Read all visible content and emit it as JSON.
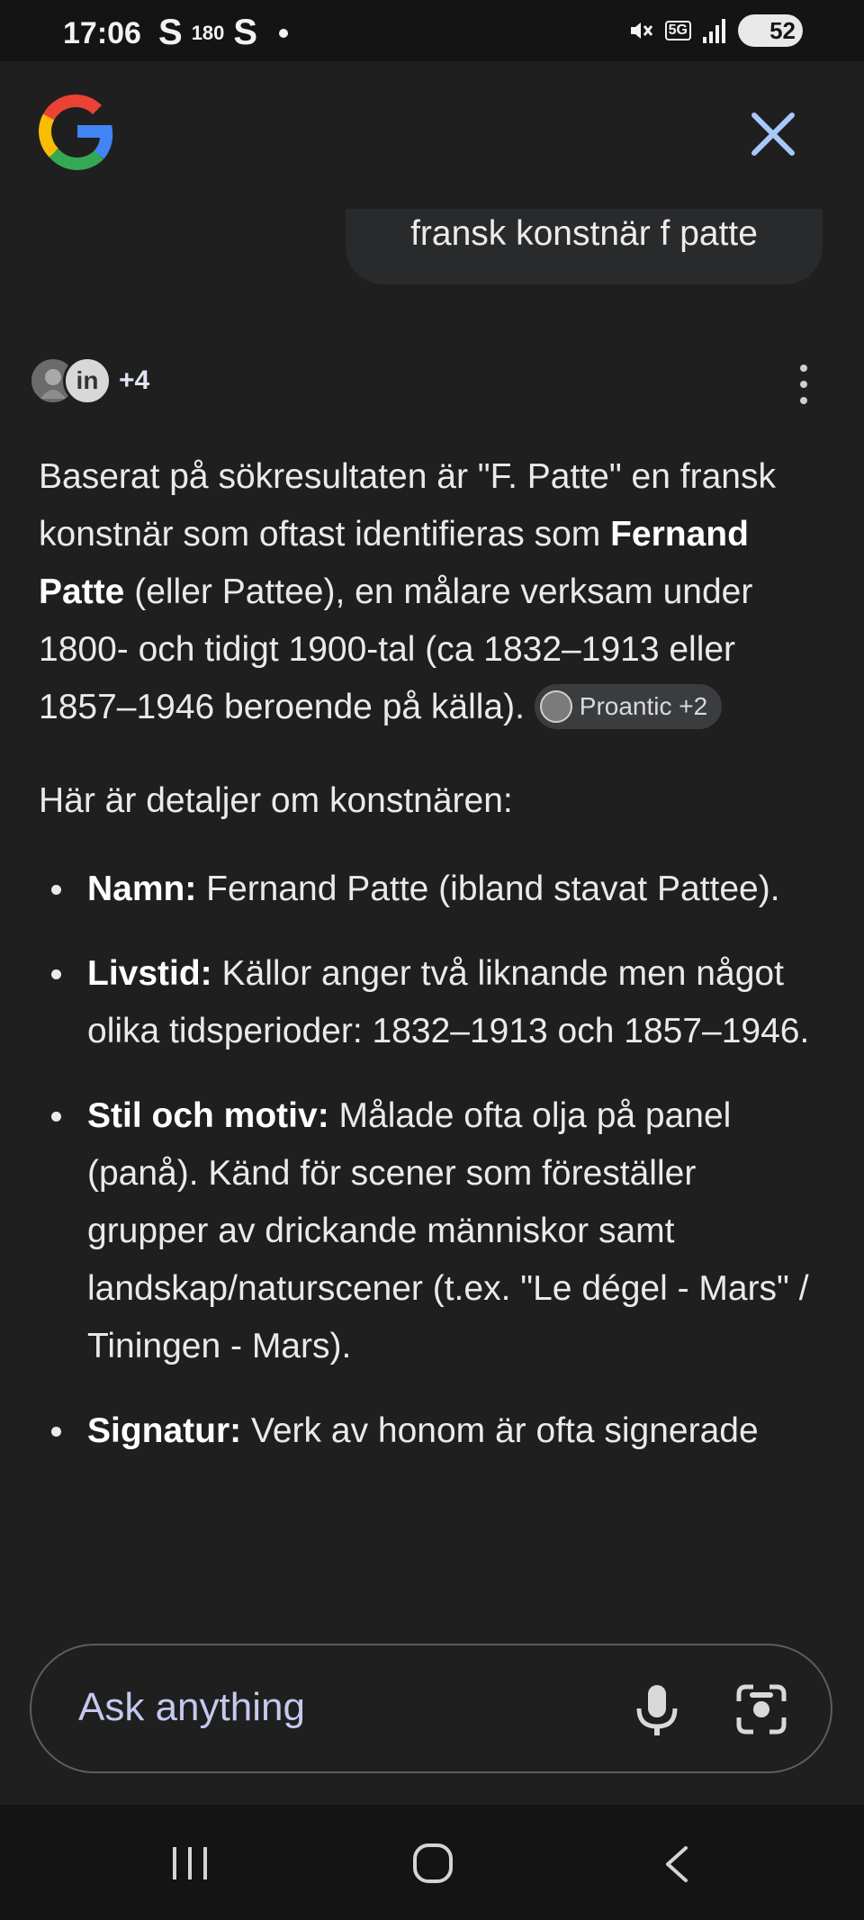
{
  "status_bar": {
    "time": "17:06",
    "left_icons": [
      "S",
      "180",
      "S"
    ],
    "network": "5G",
    "battery": "52"
  },
  "header": {
    "logo_icon": "google-g-icon",
    "close_icon": "close-icon"
  },
  "query": "fransk konstnär f patte",
  "sources": {
    "more": "+4"
  },
  "answer": {
    "intro_prefix": "Baserat på sökresultaten är \"F. Patte\" en fransk konstnär som oftast identifieras som ",
    "intro_bold": "Fernand Patte",
    "intro_suffix": " (eller Pattee), en målare verksam under 1800- och tidigt 1900-tal (ca 1832–1913 eller 1857–1946 beroende på källa). ",
    "citation": "Proantic +2",
    "details_heading": "Här är detaljer om konstnären:",
    "bullets": [
      {
        "label": "Namn:",
        "text": " Fernand Patte (ibland stavat Pattee)."
      },
      {
        "label": "Livstid:",
        "text": " Källor anger två liknande men något olika tidsperioder: 1832–1913 och 1857–1946."
      },
      {
        "label": "Stil och motiv:",
        "text": " Målade ofta olja på panel (panå). Känd för scener som föreställer grupper av drickande människor samt landskap/naturscener (t.ex. \"Le dégel - Mars\" / Tiningen - Mars)."
      },
      {
        "label": "Signatur:",
        "text": " Verk av honom är ofta signerade"
      }
    ]
  },
  "input": {
    "placeholder": "Ask anything"
  },
  "colors": {
    "background": "#1f1f1f",
    "accent_close": "#a8c7fa",
    "placeholder": "#c3c9ee"
  }
}
